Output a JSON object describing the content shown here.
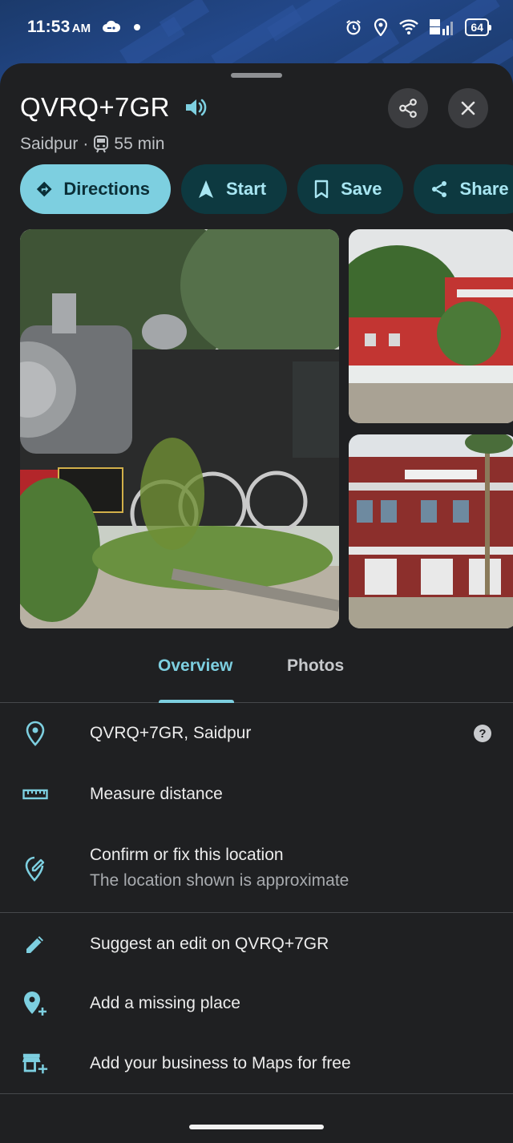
{
  "status_bar": {
    "time": "11:53",
    "ampm": "AM",
    "network": "VoLTE",
    "battery": "64"
  },
  "place": {
    "title": "QVRQ+7GR",
    "locality": "Saidpur",
    "separator": "·",
    "transit_time": "55 min"
  },
  "actions": {
    "directions": "Directions",
    "start": "Start",
    "save": "Save",
    "share": "Share"
  },
  "tabs": {
    "overview": "Overview",
    "photos": "Photos"
  },
  "details": {
    "address": "QVRQ+7GR, Saidpur",
    "measure": "Measure distance",
    "confirm_title": "Confirm or fix this location",
    "confirm_sub": "The location shown is approximate",
    "suggest_edit": "Suggest an edit on QVRQ+7GR",
    "add_place": "Add a missing place",
    "add_business": "Add your business to Maps for free"
  },
  "colors": {
    "accent": "#7dcfe0",
    "chip_dark": "#0d3940",
    "sheet_bg": "#1f2022"
  }
}
